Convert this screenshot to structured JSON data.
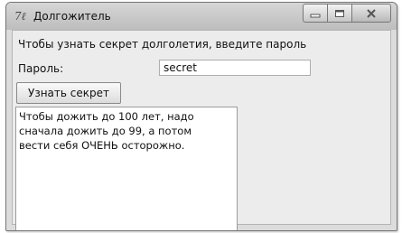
{
  "window": {
    "title": "Долгожитель",
    "app_icon_glyph": "7ℓ",
    "controls": {
      "minimize": "minimize-icon",
      "maximize": "maximize-icon",
      "close": "close-icon"
    }
  },
  "form": {
    "prompt": "Чтобы узнать секрет долголетия, введите пароль",
    "password_label": "Пароль:",
    "password_value": "secret",
    "reveal_button": "Узнать секрет",
    "answer": "Чтобы дожить до 100 лет, надо\nсначала дожить до 99, а потом\nвести себя ОЧЕНЬ осторожно."
  }
}
